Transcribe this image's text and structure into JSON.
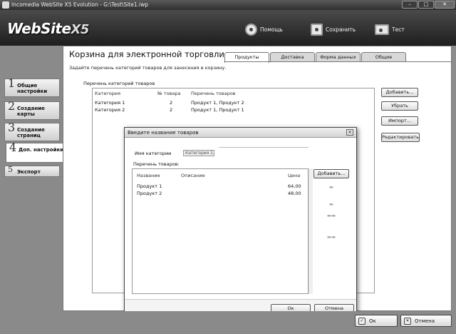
{
  "window": {
    "title": "Incomedia WebSite X5 Evolution - G:\\Test\\Site1.iwp"
  },
  "logo": {
    "text": "WebSite",
    "suffix": "X5"
  },
  "header": {
    "help": "Помощь",
    "save": "Сохранить",
    "test": "Тест"
  },
  "sidebar": {
    "items": [
      {
        "num": "1",
        "label": "Общие настройки"
      },
      {
        "num": "2",
        "label": "Создание карты"
      },
      {
        "num": "3",
        "label": "Создание страниц"
      },
      {
        "num": "4",
        "label": "Доп. настройки"
      },
      {
        "num": "5",
        "label": "Экспорт"
      }
    ]
  },
  "main": {
    "title": "Корзина для электронной торговли",
    "subtitle": "Задайте перечень категорий товаров для занесения в корзину.",
    "tabs": [
      "Продукты",
      "Доставка",
      "Форма данных",
      "Общие"
    ],
    "list_label": "Перечень категорий товаров",
    "columns": [
      "Категория",
      "№ товара",
      "Перечень товаров"
    ],
    "rows": [
      {
        "category": "Категория 1",
        "count": "2",
        "products": "Продукт 1, Продукт 2"
      },
      {
        "category": "Категория 2",
        "count": "2",
        "products": "Продукт 1, Продукт 1"
      }
    ],
    "buttons": {
      "add": "Добавить...",
      "remove": "Убрать",
      "import": "Импорт...",
      "edit": "Редактировать"
    }
  },
  "dialog": {
    "title": "Введите название товаров",
    "category_label": "Имя категории",
    "category_value": "Категория 1",
    "products_label": "Перечень товаров:",
    "columns": [
      "Название",
      "Описание",
      "Цена"
    ],
    "rows": [
      {
        "name": "Продукт 1",
        "desc": "",
        "price": "64,00"
      },
      {
        "name": "Продукт 2",
        "desc": "",
        "price": "48,00"
      }
    ],
    "add_button": "Добавить...",
    "ok": "Ок",
    "cancel": "Отмена"
  },
  "bottom": {
    "ok": "Ок",
    "cancel": "Отмена"
  }
}
